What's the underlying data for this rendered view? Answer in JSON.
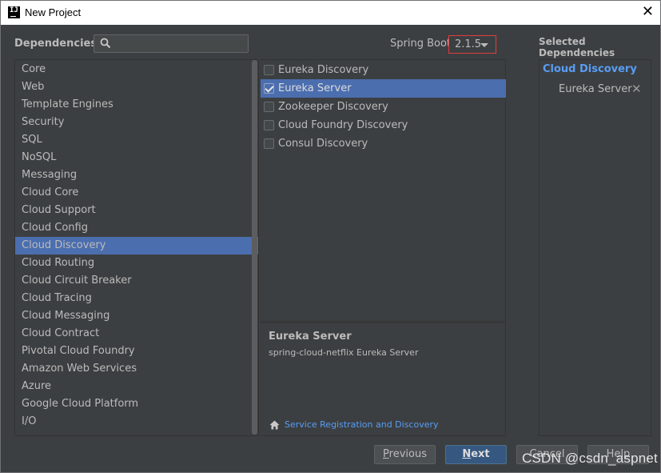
{
  "window": {
    "title": "New Project",
    "icon": "intellij-app-icon"
  },
  "dependencies_label": "Dependencies",
  "search": {
    "value": "",
    "placeholder": ""
  },
  "spring_boot": {
    "label": "Spring Boot",
    "version": "2.1.5"
  },
  "categories": [
    "Core",
    "Web",
    "Template Engines",
    "Security",
    "SQL",
    "NoSQL",
    "Messaging",
    "Cloud Core",
    "Cloud Support",
    "Cloud Config",
    "Cloud Discovery",
    "Cloud Routing",
    "Cloud Circuit Breaker",
    "Cloud Tracing",
    "Cloud Messaging",
    "Cloud Contract",
    "Pivotal Cloud Foundry",
    "Amazon Web Services",
    "Azure",
    "Google Cloud Platform",
    "I/O"
  ],
  "selected_category": "Cloud Discovery",
  "dependencies": [
    {
      "name": "Eureka Discovery",
      "checked": false,
      "selected": false
    },
    {
      "name": "Eureka Server",
      "checked": true,
      "selected": true
    },
    {
      "name": "Zookeeper Discovery",
      "checked": false,
      "selected": false
    },
    {
      "name": "Cloud Foundry Discovery",
      "checked": false,
      "selected": false
    },
    {
      "name": "Consul Discovery",
      "checked": false,
      "selected": false
    }
  ],
  "description": {
    "title": "Eureka Server",
    "text": "spring-cloud-netflix Eureka Server",
    "link": "Service Registration and Discovery"
  },
  "selected_panel": {
    "label": "Selected Dependencies",
    "group": "Cloud Discovery",
    "items": [
      "Eureka Server"
    ]
  },
  "buttons": {
    "previous": {
      "mnemonic": "P",
      "rest": "revious"
    },
    "next": {
      "mnemonic": "N",
      "rest": "ext"
    },
    "cancel": "Cancel",
    "help": "Help"
  },
  "watermark": "CSDN @csdn_aspnet",
  "colors": {
    "selection": "#4b6eaf",
    "link": "#589df6",
    "background": "#3c3f41",
    "highlight_border": "#e03c3c"
  }
}
